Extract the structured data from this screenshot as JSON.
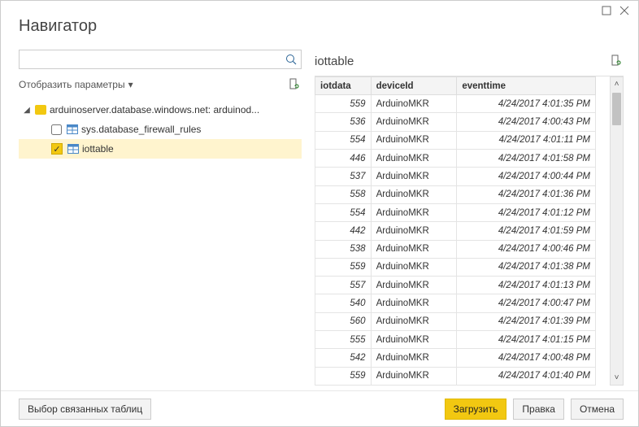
{
  "windowTitle": "Навигатор",
  "search": {
    "placeholder": ""
  },
  "params": {
    "label": "Отобразить параметры"
  },
  "tree": {
    "root": "arduinoserver.database.windows.net: arduinod...",
    "child1": {
      "label": "sys.database_firewall_rules",
      "checked": false
    },
    "child2": {
      "label": "iottable",
      "checked": true
    }
  },
  "previewName": "iottable",
  "columns": [
    "iotdata",
    "deviceId",
    "eventtime"
  ],
  "rows": [
    {
      "iotdata": 559,
      "deviceId": "ArduinoMKR",
      "eventtime": "4/24/2017 4:01:35 PM"
    },
    {
      "iotdata": 536,
      "deviceId": "ArduinoMKR",
      "eventtime": "4/24/2017 4:00:43 PM"
    },
    {
      "iotdata": 554,
      "deviceId": "ArduinoMKR",
      "eventtime": "4/24/2017 4:01:11 PM"
    },
    {
      "iotdata": 446,
      "deviceId": "ArduinoMKR",
      "eventtime": "4/24/2017 4:01:58 PM"
    },
    {
      "iotdata": 537,
      "deviceId": "ArduinoMKR",
      "eventtime": "4/24/2017 4:00:44 PM"
    },
    {
      "iotdata": 558,
      "deviceId": "ArduinoMKR",
      "eventtime": "4/24/2017 4:01:36 PM"
    },
    {
      "iotdata": 554,
      "deviceId": "ArduinoMKR",
      "eventtime": "4/24/2017 4:01:12 PM"
    },
    {
      "iotdata": 442,
      "deviceId": "ArduinoMKR",
      "eventtime": "4/24/2017 4:01:59 PM"
    },
    {
      "iotdata": 538,
      "deviceId": "ArduinoMKR",
      "eventtime": "4/24/2017 4:00:46 PM"
    },
    {
      "iotdata": 559,
      "deviceId": "ArduinoMKR",
      "eventtime": "4/24/2017 4:01:38 PM"
    },
    {
      "iotdata": 557,
      "deviceId": "ArduinoMKR",
      "eventtime": "4/24/2017 4:01:13 PM"
    },
    {
      "iotdata": 540,
      "deviceId": "ArduinoMKR",
      "eventtime": "4/24/2017 4:00:47 PM"
    },
    {
      "iotdata": 560,
      "deviceId": "ArduinoMKR",
      "eventtime": "4/24/2017 4:01:39 PM"
    },
    {
      "iotdata": 555,
      "deviceId": "ArduinoMKR",
      "eventtime": "4/24/2017 4:01:15 PM"
    },
    {
      "iotdata": 542,
      "deviceId": "ArduinoMKR",
      "eventtime": "4/24/2017 4:00:48 PM"
    },
    {
      "iotdata": 559,
      "deviceId": "ArduinoMKR",
      "eventtime": "4/24/2017 4:01:40 PM"
    }
  ],
  "footer": {
    "related": "Выбор связанных таблиц",
    "load": "Загрузить",
    "edit": "Правка",
    "cancel": "Отмена"
  }
}
